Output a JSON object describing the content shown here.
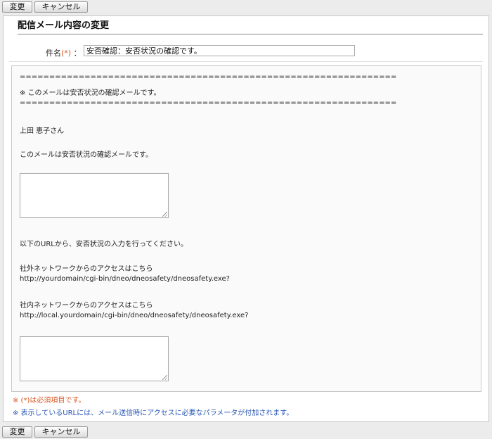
{
  "toolbar": {
    "change_label": "変更",
    "cancel_label": "キャンセル"
  },
  "panel": {
    "title": "配信メール内容の変更"
  },
  "subject": {
    "label": "件名",
    "required_mark": "(*)",
    "colon": "：",
    "value": "安否確認：安否状況の確認です。"
  },
  "body": {
    "rule_top": "================================================================",
    "headline": "※ このメールは安否状況の確認メールです。",
    "rule_bottom": "================================================================",
    "recipient": "上田 恵子さん",
    "message": "このメールは安否状況の確認メールです。",
    "instruction": "以下のURLから、安否状況の入力を行ってください。",
    "external_label": "社外ネットワークからのアクセスはこちら",
    "external_url": "http://yourdomain/cgi-bin/dneo/dneosafety/dneosafety.exe?",
    "internal_label": "社内ネットワークからのアクセスはこちら",
    "internal_url": "http://local.yourdomain/cgi-bin/dneo/dneosafety/dneosafety.exe?"
  },
  "notes": {
    "required": "※ (*)は必須項目です。",
    "url_param": "※ 表示しているURLには、メール送信時にアクセスに必要なパラメータが付加されます。"
  },
  "colors": {
    "required": "#d9541e",
    "note_blue": "#2b58b5"
  }
}
